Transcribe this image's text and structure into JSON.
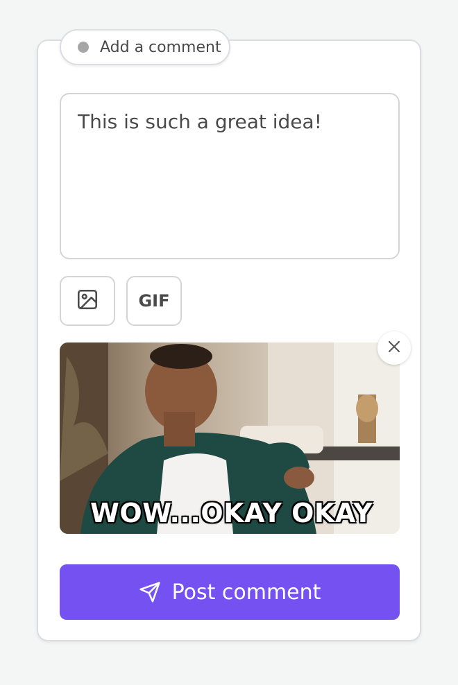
{
  "tab": {
    "label": "Add a comment",
    "dot_color": "#a6a6a6"
  },
  "comment": {
    "value": "This is such a great idea!"
  },
  "toolbar": {
    "image_icon": "image-icon",
    "gif_label": "GIF"
  },
  "gif": {
    "caption": "WOW...OKAY OKAY",
    "remove_icon": "close-icon"
  },
  "submit": {
    "label": "Post comment",
    "icon": "send-icon",
    "color": "#7551f2"
  }
}
